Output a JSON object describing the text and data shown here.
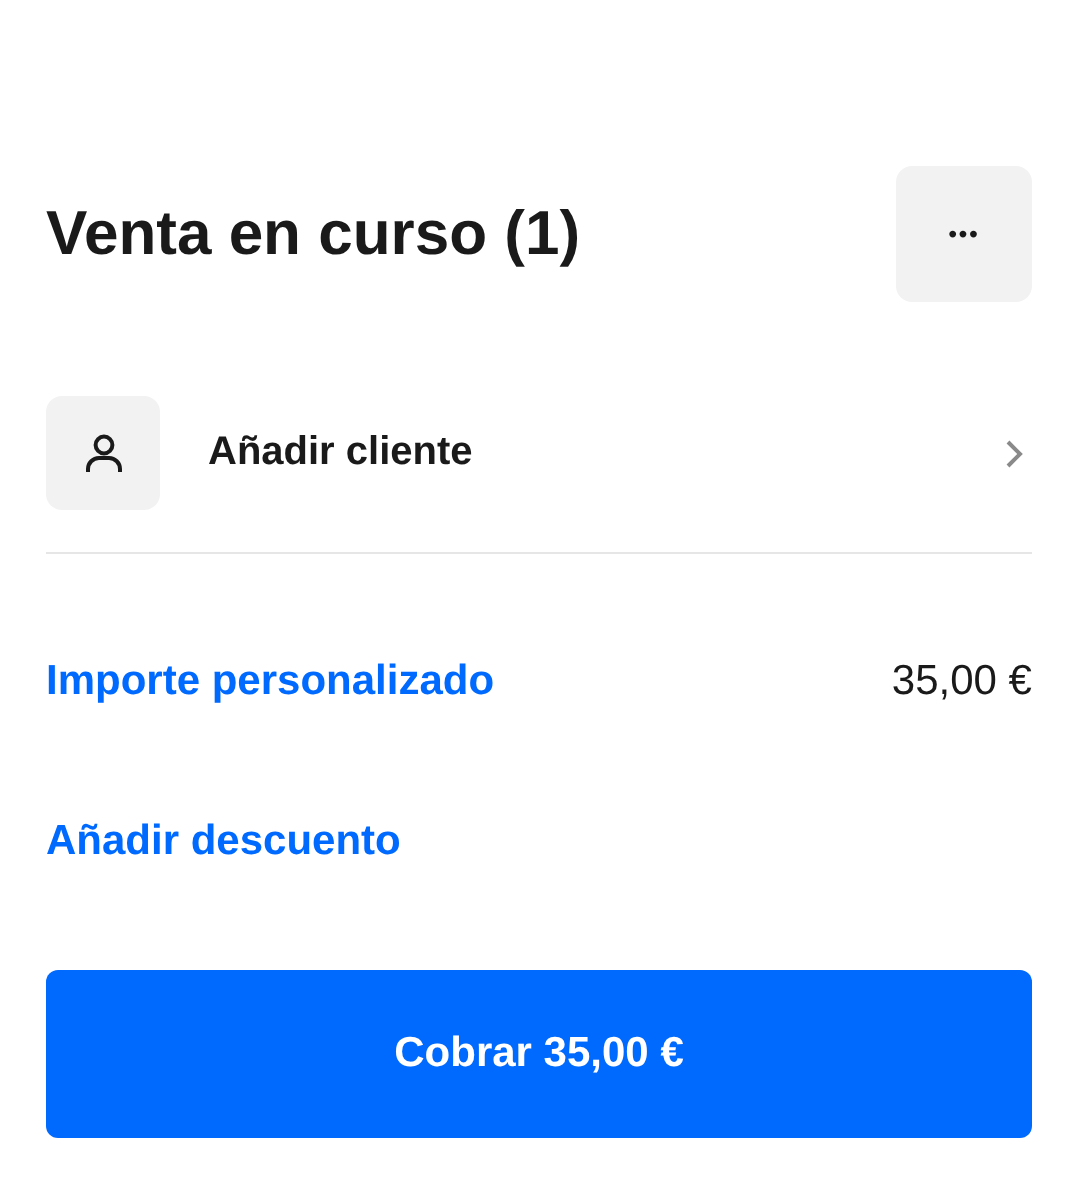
{
  "header": {
    "title": "Venta en curso (1)",
    "more_button": "•••"
  },
  "customer": {
    "label": "Añadir cliente"
  },
  "lines": [
    {
      "label": "Importe personalizado",
      "amount": "35,00 €"
    },
    {
      "label": "Añadir descuento"
    }
  ],
  "charge_button": "Cobrar 35,00 €"
}
